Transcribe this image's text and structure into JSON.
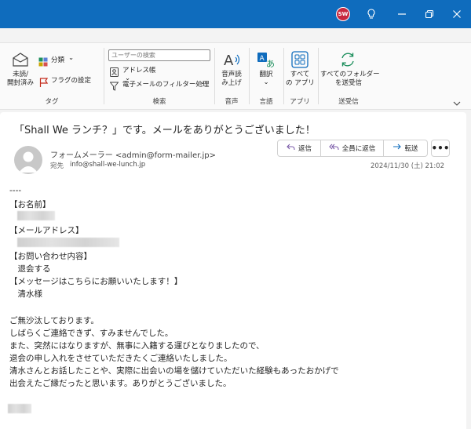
{
  "titlebar": {
    "avatar_initials": "SW"
  },
  "ribbon": {
    "tag_group": {
      "unread_read": [
        "未読/",
        "開封済み"
      ],
      "categorize": "分類",
      "flag": "フラグの設定",
      "label": "タグ"
    },
    "search_group": {
      "search_placeholder": "ユーザーの検索",
      "address_book": "アドレス帳",
      "email_filter": "電子メールのフィルター処理",
      "label": "検索"
    },
    "speech_group": {
      "read_aloud": [
        "音声読",
        "み上げ"
      ],
      "label": "音声"
    },
    "language_group": {
      "translate": "翻訳",
      "label": "言語"
    },
    "apps_group": {
      "all_apps": [
        "すべて",
        "の アプリ"
      ],
      "label": "アプリ"
    },
    "sendreceive_group": {
      "send_receive_all": [
        "すべてのフォルダー",
        "を送受信"
      ],
      "label": "送受信"
    }
  },
  "message": {
    "subject": "「Shall We ランチ？」です。メールをありがとうございました！",
    "sender": "フォームメーラー <admin@form-mailer.jp>",
    "to_label": "宛先",
    "to_value": "info@shall-we-lunch.jp",
    "date": "2024/11/30 (土) 21:02",
    "actions": {
      "reply": "返信",
      "reply_all": "全員に返信",
      "forward": "転送",
      "more": "•••"
    },
    "body": {
      "separator": "----",
      "name_label": "【お名前】",
      "email_label": "【メールアドレス】",
      "inquiry_label": "【お問い合わせ内容】",
      "inquiry_value": "　退会する",
      "message_label": "【メッセージはこちらにお願いいたします！】",
      "message_value": "　清水様",
      "line1": "ご無沙汰しております。",
      "line2": "しばらくご連絡できず、すみませんでした。",
      "line3": "また、突然にはなりますが、無事に入籍する運びとなりましたので、",
      "line4": "退会の申し入れをさせていただきたくご連絡いたしました。",
      "line5": "清水さんとお話したことや、実際に出会いの場を儲けていただいた経験もあったおかげで",
      "line6": "出会えたご縁だったと思います。ありがとうございました。"
    }
  }
}
